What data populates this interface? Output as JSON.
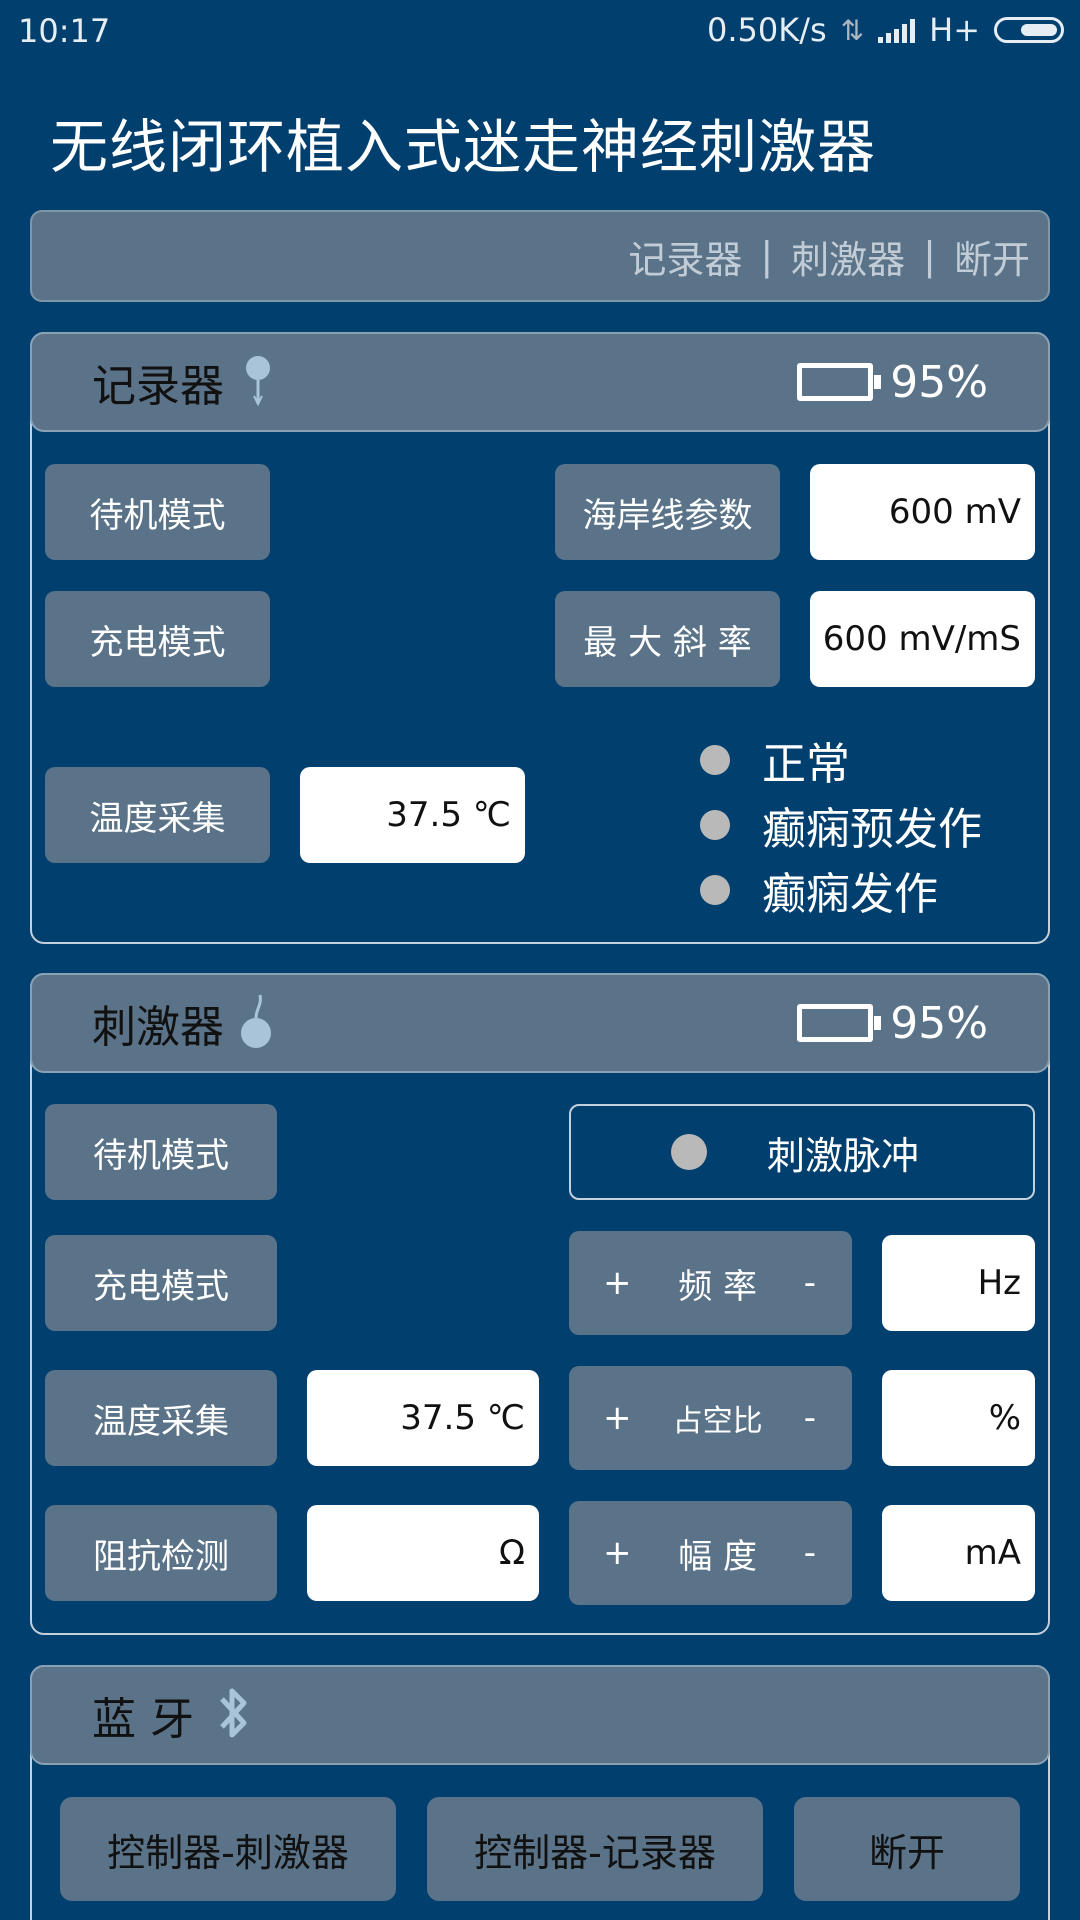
{
  "status_bar": {
    "time": "10:17",
    "net_speed": "0.50K/s",
    "network_type": "H+",
    "icons": [
      "data-arrows-icon",
      "signal-icon",
      "battery-icon"
    ]
  },
  "app_title": "无线闭环植入式迷走神经刺激器",
  "menu": {
    "items": [
      "记录器",
      "刺激器",
      "断开"
    ],
    "separator": "|"
  },
  "recorder": {
    "title": "记录器",
    "battery": "95%",
    "standby_label": "待机模式",
    "charge_label": "充电模式",
    "temp_label": "温度采集",
    "temp_value": "37.5 ℃",
    "coastline_label": "海岸线参数",
    "coastline_value": "600 mV",
    "slope_label": "最 大 斜 率",
    "slope_value": "600 mV/mS",
    "states": [
      "正常",
      "癫痫预发作",
      "癫痫发作"
    ]
  },
  "stimulator": {
    "title": "刺激器",
    "battery": "95%",
    "standby_label": "待机模式",
    "charge_label": "充电模式",
    "temp_label": "温度采集",
    "temp_value": "37.5 ℃",
    "impedance_label": "阻抗检测",
    "impedance_value": "Ω",
    "pulse_label": "刺激脉冲",
    "plus": "+",
    "minus": "-",
    "frequency_label": "频 率",
    "frequency_unit": "Hz",
    "duty_label": "占空比",
    "duty_unit": "%",
    "amplitude_label": "幅 度",
    "amplitude_unit": "mA"
  },
  "bluetooth": {
    "title": "蓝 牙",
    "buttons": [
      "控制器-刺激器",
      "控制器-记录器",
      "断开"
    ]
  },
  "colors": {
    "background": "#003f6e",
    "panel": "#5a7388",
    "indicator": "#b9b9b9"
  }
}
